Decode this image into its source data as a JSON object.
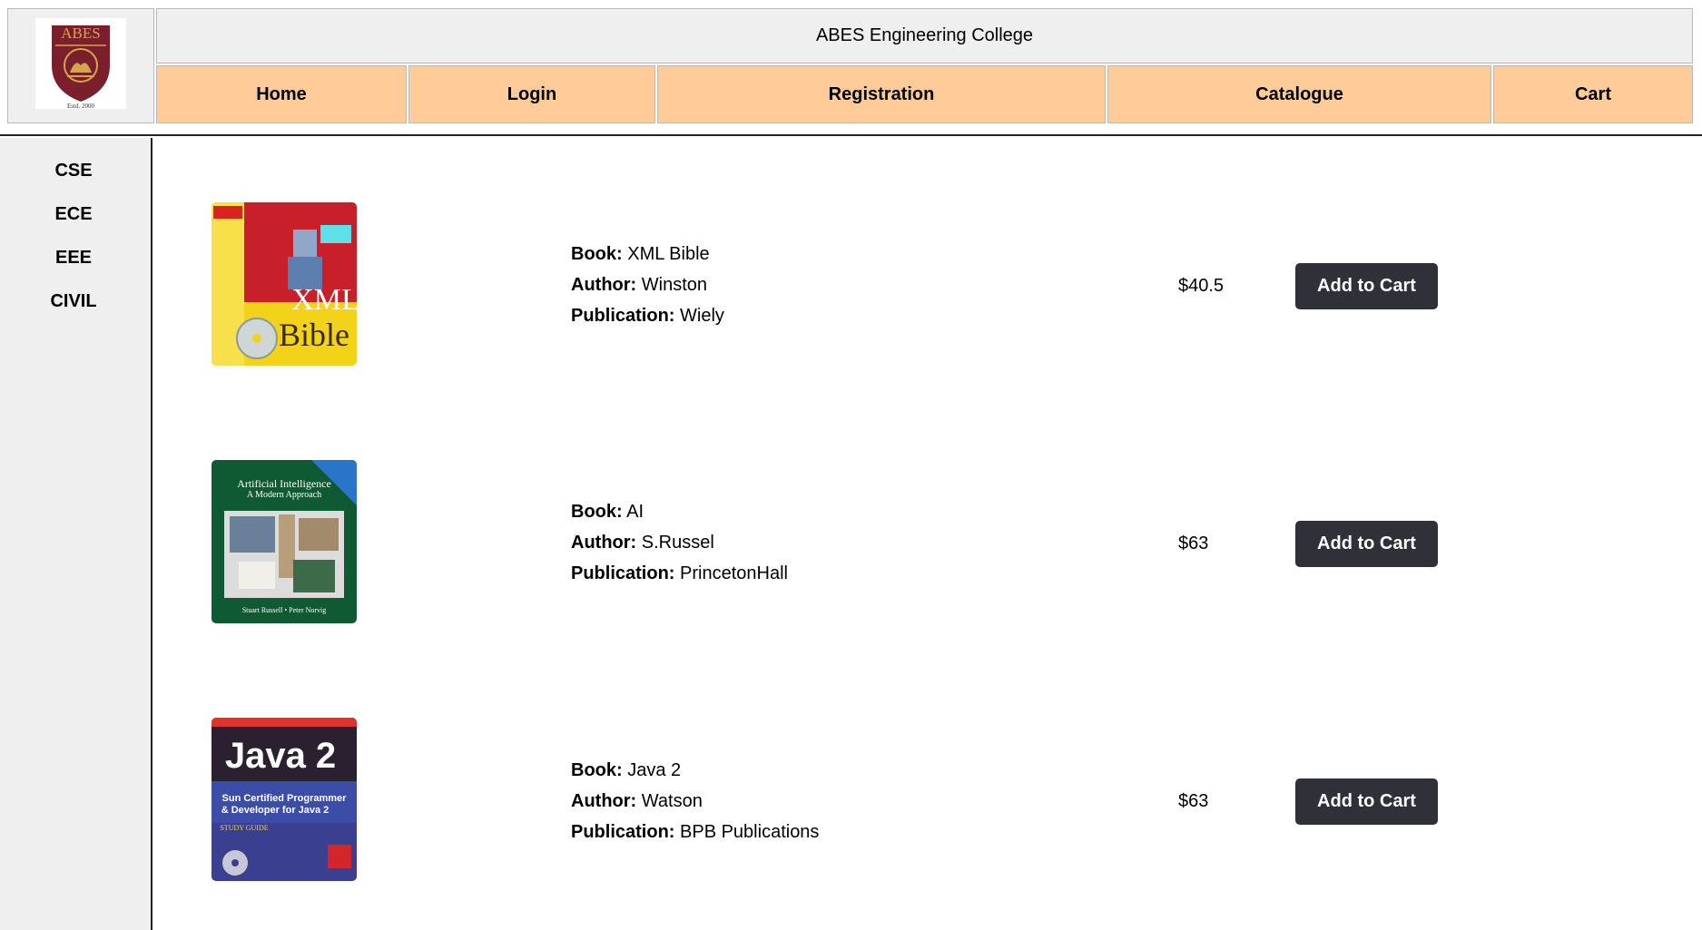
{
  "header": {
    "logo_text": "ABES",
    "logo_est": "Estd. 2000",
    "college_name": "ABES Engineering College",
    "nav": [
      "Home",
      "Login",
      "Registration",
      "Catalogue",
      "Cart"
    ]
  },
  "sidebar": {
    "items": [
      "CSE",
      "ECE",
      "EEE",
      "CIVIL"
    ]
  },
  "labels": {
    "book": "Book:",
    "author": "Author:",
    "publication": "Publication:"
  },
  "books": [
    {
      "title": "XML Bible",
      "author": "Winston",
      "publication": "Wiely",
      "price": "$40.5",
      "button": "Add to Cart",
      "cover_text": [
        "XML",
        "Bible"
      ]
    },
    {
      "title": "AI",
      "author": "S.Russel",
      "publication": "PrincetonHall",
      "price": "$63",
      "button": "Add to Cart",
      "cover_text": [
        "Artificial Intelligence",
        "A Modern Approach",
        "Stuart Russell • Peter Norvig"
      ]
    },
    {
      "title": "Java 2",
      "author": "Watson",
      "publication": "BPB Publications",
      "price": "$63",
      "button": "Add to Cart",
      "cover_text": [
        "Java 2",
        "Sun Certified Programmer",
        "& Developer for Java 2",
        "STUDY GUIDE"
      ]
    }
  ],
  "colors": {
    "nav_bg": "#ffcc99",
    "panel_bg": "#efefef",
    "button_bg": "#2f3038",
    "crest": "#7a1f2b",
    "crest_gold": "#d4a64a"
  }
}
